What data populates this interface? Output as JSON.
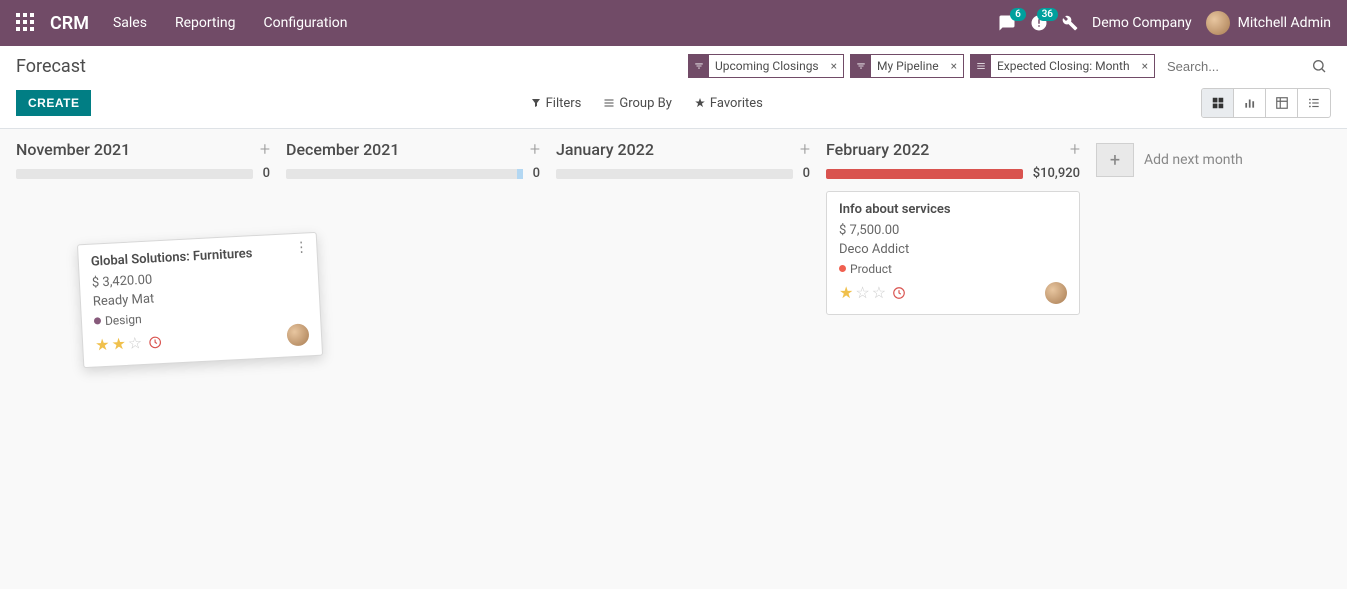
{
  "navbar": {
    "brand": "CRM",
    "links": [
      "Sales",
      "Reporting",
      "Configuration"
    ],
    "messages_badge": "6",
    "activities_badge": "36",
    "company": "Demo Company",
    "user": "Mitchell Admin"
  },
  "breadcrumb": "Forecast",
  "create_label": "CREATE",
  "search": {
    "placeholder": "Search...",
    "facets": [
      {
        "type": "filter",
        "label": "Upcoming Closings"
      },
      {
        "type": "filter",
        "label": "My Pipeline"
      },
      {
        "type": "group",
        "label": "Expected Closing: Month"
      }
    ]
  },
  "toolbar": {
    "filters": "Filters",
    "groupby": "Group By",
    "favorites": "Favorites"
  },
  "columns": [
    {
      "title": "November 2021",
      "total": "0",
      "bar": "empty"
    },
    {
      "title": "December 2021",
      "total": "0",
      "bar": "partial"
    },
    {
      "title": "January 2022",
      "total": "0",
      "bar": "empty"
    },
    {
      "title": "February 2022",
      "total": "$10,920",
      "bar": "red"
    }
  ],
  "cards": {
    "dragging": {
      "title": "Global Solutions: Furnitures",
      "amount": "$ 3,420.00",
      "customer": "Ready Mat",
      "tag": "Design",
      "tag_color": "#875A7B",
      "stars": 2
    },
    "feb": {
      "title": "Info about services",
      "amount": "$ 7,500.00",
      "customer": "Deco Addict",
      "tag": "Product",
      "tag_color": "#f06050",
      "stars": 1
    }
  },
  "add_month": "Add next month"
}
